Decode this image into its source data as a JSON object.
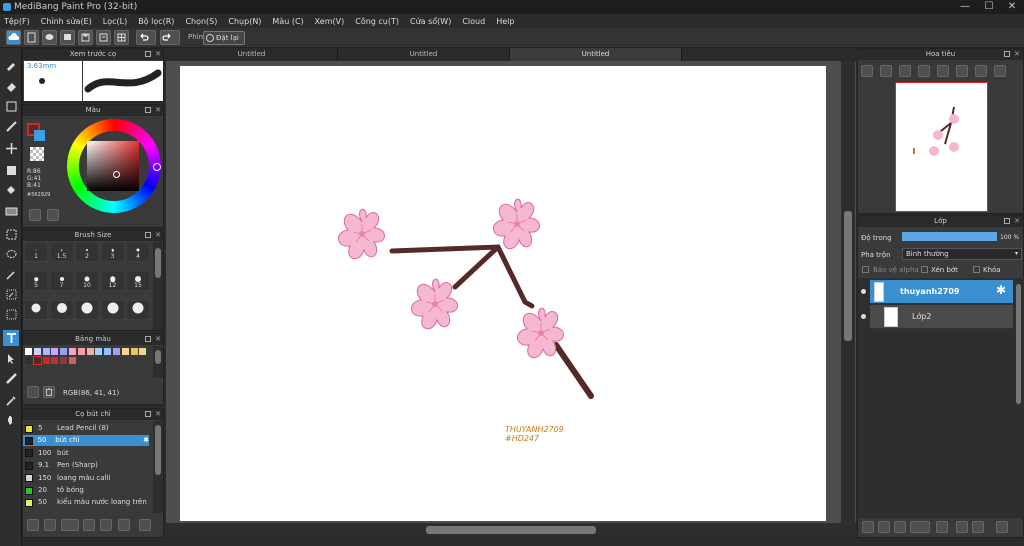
{
  "window": {
    "title": "MediBang Paint Pro (32-bit)",
    "minimize": "—",
    "maximize": "☐",
    "close": "✕"
  },
  "menu": [
    "Tệp(F)",
    "Chỉnh sửa(E)",
    "Lọc(L)",
    "Bộ lọc(R)",
    "Chọn(S)",
    "Chụp(N)",
    "Màu (C)",
    "Xem(V)",
    "Công cụ(T)",
    "Cửa sổ(W)",
    "Cloud",
    "Help"
  ],
  "toolbar": {
    "pen_label": "Phím",
    "reset_label": "Đặt lại"
  },
  "tabs": [
    "Untitled",
    "Untitled",
    "Untitled"
  ],
  "brush_preview": {
    "title": "Xem trước cọ",
    "size": "3.63mm"
  },
  "color": {
    "title": "Màu",
    "r": "R:86",
    "g": "G:41",
    "b": "B:41",
    "hex": "#562929",
    "current_hex": "#562929"
  },
  "brush_size": {
    "title": "Brush Size",
    "sizes": [
      "1",
      "1.5",
      "2",
      "3",
      "4",
      "5",
      "7",
      "10",
      "12",
      "15",
      "",
      "",
      "",
      "",
      ""
    ]
  },
  "palette": {
    "title": "Bảng màu",
    "rgb_label": "RGB(86, 41, 41)",
    "colors": [
      "#ffffff",
      "#d0d0ff",
      "#a8b8ff",
      "#c8a8ff",
      "#9aa0f0",
      "#f0a8c8",
      "#ff9aa0",
      "#f0b0b0",
      "#a0d0ff",
      "#90c0ff",
      "#a0a0f0",
      "#ffd0a0",
      "#f0c060",
      "#e8d890",
      "#303030",
      "#562929",
      "#e02020",
      "#c03030",
      "#8a3a3a",
      "#d06060"
    ]
  },
  "brush_list": {
    "title": "Cọ bút chì",
    "items": [
      {
        "num": "5",
        "name": "Lead Pencil (8)",
        "color": "#f0e030"
      },
      {
        "num": "50",
        "name": "bút chì",
        "color": "#222222"
      },
      {
        "num": "100",
        "name": "bút",
        "color": "#222222"
      },
      {
        "num": "9.1",
        "name": "Pen (Sharp)",
        "color": "#222222"
      },
      {
        "num": "150",
        "name": "loang màu calli",
        "color": "#d8d8d8"
      },
      {
        "num": "20",
        "name": "tô bóng",
        "color": "#30c030"
      },
      {
        "num": "50",
        "name": "kiểu màu nước loang trên",
        "color": "#e0f060"
      }
    ]
  },
  "navigator": {
    "title": "Hoa tiêu"
  },
  "layers": {
    "title": "Lớp",
    "opacity_label": "Độ trong",
    "opacity_value": "100 %",
    "opacity": 1.0,
    "blend_label": "Pha trộn",
    "blend_value": "Bình thường",
    "protect_alpha": "Bảo vệ alpha",
    "clipping": "Xén bớt",
    "lock": "Khóa",
    "items": [
      {
        "name": "thuyanh2709",
        "selected": true
      },
      {
        "name": "Lớp2",
        "selected": false
      }
    ]
  },
  "canvas": {
    "signature_line1": "THUYANH2709",
    "signature_line2": "#HD247",
    "branch_color": "#562929",
    "petal_color": "#f5b8d0",
    "petal_stroke": "#d86aa0"
  }
}
